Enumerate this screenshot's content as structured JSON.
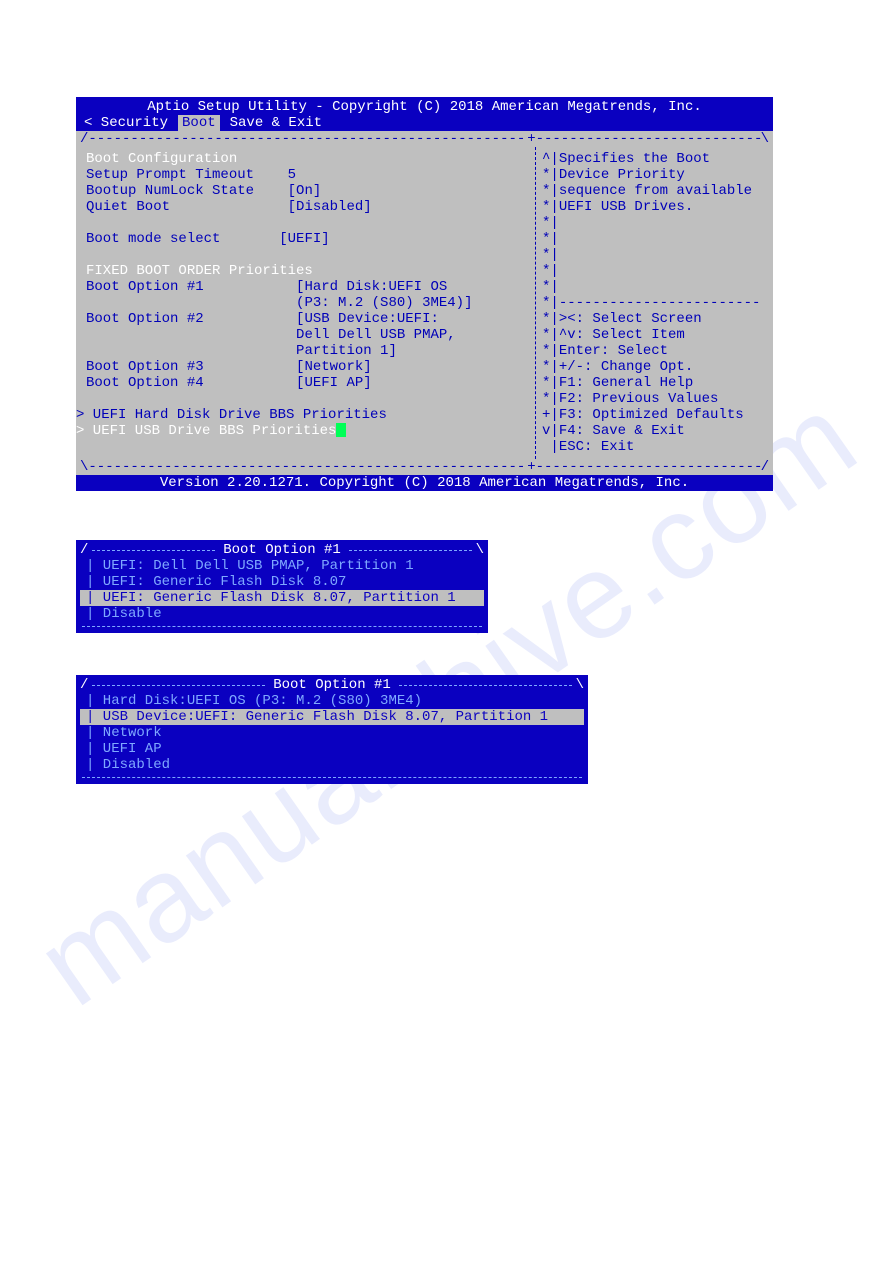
{
  "bios": {
    "title": "Aptio Setup Utility - Copyright (C) 2018 American Megatrends, Inc.",
    "tabs": {
      "prev": "< Security",
      "current": "Boot",
      "next": "Save & Exit"
    },
    "sections": {
      "config_header": "Boot Configuration",
      "setup_prompt": {
        "label": "Setup Prompt Timeout",
        "value": "5"
      },
      "numlock": {
        "label": "Bootup NumLock State",
        "value": "[On]"
      },
      "quiet": {
        "label": "Quiet Boot",
        "value": "[Disabled]"
      },
      "bootmode": {
        "label": "Boot mode select",
        "value": "[UEFI]"
      },
      "fixed_header": "FIXED BOOT ORDER Priorities",
      "opt1": {
        "label": "Boot Option #1",
        "v1": "[Hard Disk:UEFI OS",
        "v2": "(P3: M.2 (S80) 3ME4)]"
      },
      "opt2": {
        "label": "Boot Option #2",
        "v1": "[USB Device:UEFI:",
        "v2": "Dell Dell USB PMAP,",
        "v3": "Partition 1]"
      },
      "opt3": {
        "label": "Boot Option #3",
        "v1": "[Network]"
      },
      "opt4": {
        "label": "Boot Option #4",
        "v1": "[UEFI AP]"
      },
      "sub1": "> UEFI Hard Disk Drive BBS Priorities",
      "sub2": "> UEFI USB Drive BBS Priorities"
    },
    "help": {
      "l1": "Specifies the Boot",
      "l2": "Device Priority",
      "l3": "sequence from available",
      "l4": "UEFI USB Drives.",
      "k1": "><: Select Screen",
      "k2": "^v: Select Item",
      "k3": "Enter: Select",
      "k4": "+/-: Change Opt.",
      "k5": "F1: General Help",
      "k6": "F2: Previous Values",
      "k7": "F3: Optimized Defaults",
      "k8": "F4: Save & Exit",
      "k9": "ESC: Exit"
    },
    "footer": "Version 2.20.1271. Copyright (C) 2018 American Megatrends, Inc."
  },
  "popup1": {
    "title": "Boot Option #1",
    "options": [
      "UEFI: Dell Dell USB PMAP, Partition 1",
      "UEFI: Generic Flash Disk 8.07",
      "UEFI: Generic Flash Disk 8.07, Partition 1",
      "Disable"
    ],
    "selected_index": 2
  },
  "popup2": {
    "title": "Boot Option #1",
    "options": [
      "Hard Disk:UEFI OS (P3: M.2 (S80) 3ME4)",
      "USB Device:UEFI: Generic Flash Disk 8.07, Partition 1",
      "Network",
      "UEFI AP",
      "Disabled"
    ],
    "selected_index": 1
  }
}
